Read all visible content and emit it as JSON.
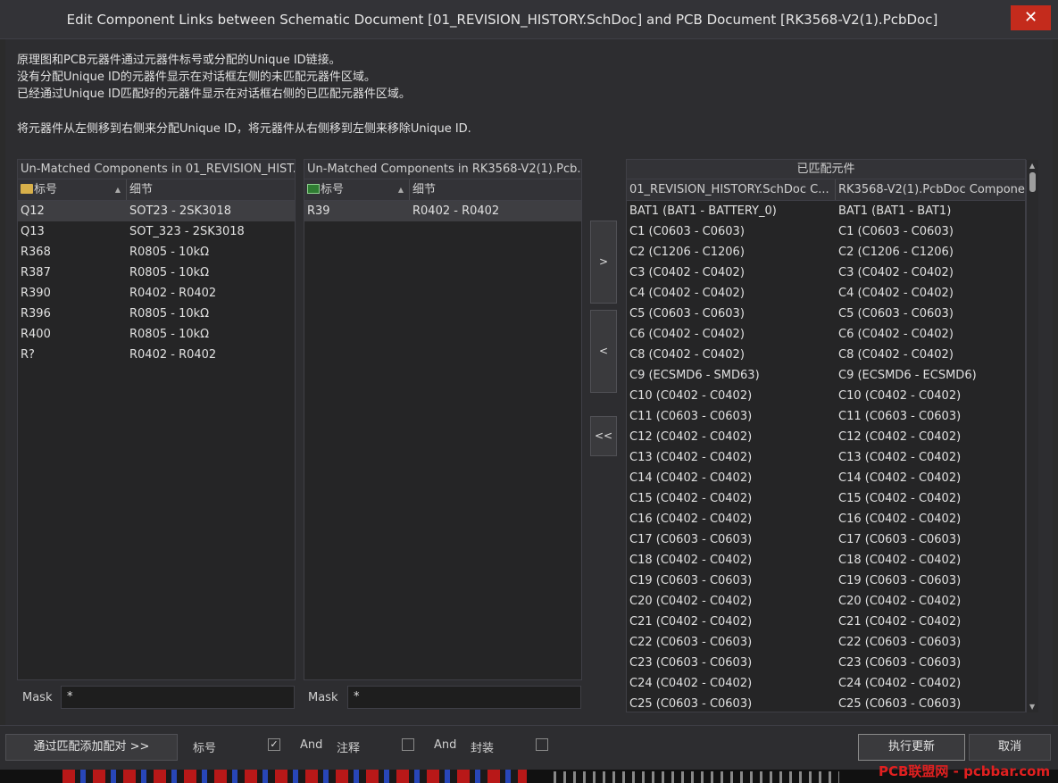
{
  "window": {
    "title": "Edit Component Links between Schematic Document [01_REVISION_HISTORY.SchDoc] and PCB Document [RK3568-V2(1).PcbDoc]",
    "close_glyph": "✕"
  },
  "instructions": [
    "原理图和PCB元器件通过元器件标号或分配的Unique ID链接。",
    "没有分配Unique ID的元器件显示在对话框左侧的未匹配元器件区域。",
    "已经通过Unique ID匹配好的元器件显示在对话框右侧的已匹配元器件区域。",
    "将元器件从左侧移到右侧来分配Unique ID，将元器件从右侧移到左侧来移除Unique ID."
  ],
  "sch_panel": {
    "title": "Un-Matched Components in 01_REVISION_HIST...",
    "col_designator": "标号",
    "col_details": "细节",
    "rows": [
      {
        "designator": "Q12",
        "details": "SOT23 - 2SK3018"
      },
      {
        "designator": "Q13",
        "details": "SOT_323 - 2SK3018"
      },
      {
        "designator": "R368",
        "details": "R0805 - 10kΩ"
      },
      {
        "designator": "R387",
        "details": "R0805 - 10kΩ"
      },
      {
        "designator": "R390",
        "details": "R0402 - R0402"
      },
      {
        "designator": "R396",
        "details": "R0805 - 10kΩ"
      },
      {
        "designator": "R400",
        "details": "R0805 - 10kΩ"
      },
      {
        "designator": "R?",
        "details": "R0402 - R0402"
      }
    ],
    "mask_label": "Mask",
    "mask_value": "*"
  },
  "pcb_panel": {
    "title": "Un-Matched Components in RK3568-V2(1).Pcb...",
    "col_designator": "标号",
    "col_details": "细节",
    "rows": [
      {
        "designator": "R39",
        "details": "R0402 - R0402"
      }
    ],
    "mask_label": "Mask",
    "mask_value": "*"
  },
  "arrows": {
    "add": ">",
    "remove": "<",
    "remove_all": "<<"
  },
  "matched_panel": {
    "title": "已匹配元件",
    "col_sch": "01_REVISION_HISTORY.SchDoc C...",
    "col_pcb": "RK3568-V2(1).PcbDoc Compone...",
    "rows": [
      {
        "sch": "BAT1 (BAT1 - BATTERY_0)",
        "pcb": "BAT1 (BAT1 - BAT1)"
      },
      {
        "sch": "C1 (C0603 - C0603)",
        "pcb": "C1 (C0603 - C0603)"
      },
      {
        "sch": "C2 (C1206 - C1206)",
        "pcb": "C2 (C1206 - C1206)"
      },
      {
        "sch": "C3 (C0402 - C0402)",
        "pcb": "C3 (C0402 - C0402)"
      },
      {
        "sch": "C4 (C0402 - C0402)",
        "pcb": "C4 (C0402 - C0402)"
      },
      {
        "sch": "C5 (C0603 - C0603)",
        "pcb": "C5 (C0603 - C0603)"
      },
      {
        "sch": "C6 (C0402 - C0402)",
        "pcb": "C6 (C0402 - C0402)"
      },
      {
        "sch": "C8 (C0402 - C0402)",
        "pcb": "C8 (C0402 - C0402)"
      },
      {
        "sch": "C9 (ECSMD6 - SMD63)",
        "pcb": "C9 (ECSMD6 - ECSMD6)"
      },
      {
        "sch": "C10 (C0402 - C0402)",
        "pcb": "C10 (C0402 - C0402)"
      },
      {
        "sch": "C11 (C0603 - C0603)",
        "pcb": "C11 (C0603 - C0603)"
      },
      {
        "sch": "C12 (C0402 - C0402)",
        "pcb": "C12 (C0402 - C0402)"
      },
      {
        "sch": "C13 (C0402 - C0402)",
        "pcb": "C13 (C0402 - C0402)"
      },
      {
        "sch": "C14 (C0402 - C0402)",
        "pcb": "C14 (C0402 - C0402)"
      },
      {
        "sch": "C15 (C0402 - C0402)",
        "pcb": "C15 (C0402 - C0402)"
      },
      {
        "sch": "C16 (C0402 - C0402)",
        "pcb": "C16 (C0402 - C0402)"
      },
      {
        "sch": "C17 (C0603 - C0603)",
        "pcb": "C17 (C0603 - C0603)"
      },
      {
        "sch": "C18 (C0402 - C0402)",
        "pcb": "C18 (C0402 - C0402)"
      },
      {
        "sch": "C19 (C0603 - C0603)",
        "pcb": "C19 (C0603 - C0603)"
      },
      {
        "sch": "C20 (C0402 - C0402)",
        "pcb": "C20 (C0402 - C0402)"
      },
      {
        "sch": "C21 (C0402 - C0402)",
        "pcb": "C21 (C0402 - C0402)"
      },
      {
        "sch": "C22 (C0603 - C0603)",
        "pcb": "C22 (C0603 - C0603)"
      },
      {
        "sch": "C23 (C0603 - C0603)",
        "pcb": "C23 (C0603 - C0603)"
      },
      {
        "sch": "C24 (C0402 - C0402)",
        "pcb": "C24 (C0402 - C0402)"
      },
      {
        "sch": "C25 (C0603 - C0603)",
        "pcb": "C25 (C0603 - C0603)"
      }
    ]
  },
  "bottom": {
    "add_pairs_button": "通过匹配添加配对 >>",
    "designator_label": "标号",
    "designator_checked": true,
    "and1": "And",
    "comment_label": "注释",
    "comment_checked": false,
    "and2": "And",
    "footprint_label": "封装",
    "footprint_checked": false,
    "execute_button": "执行更新",
    "cancel_button": "取消"
  },
  "watermark": "PCB联盟网 - pcbbar.com"
}
